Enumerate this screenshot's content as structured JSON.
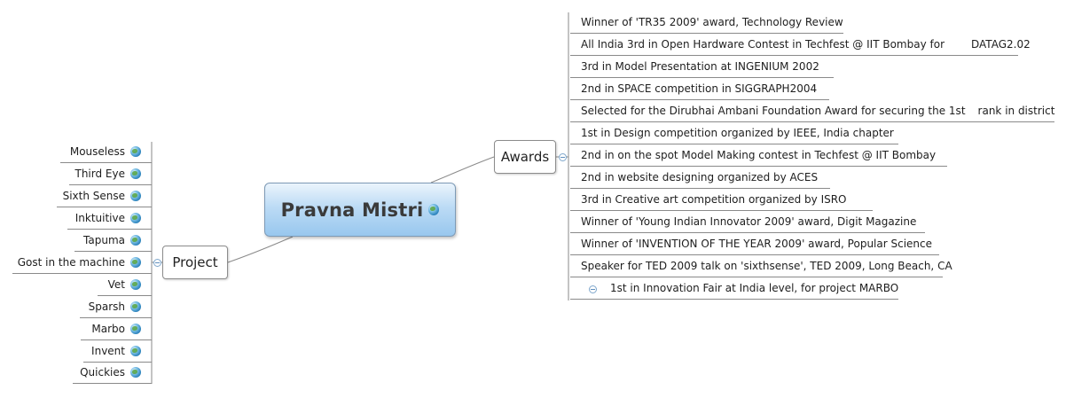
{
  "central": {
    "title": "Pravna Mistri",
    "icon": "globe-icon"
  },
  "awards": {
    "label": "Awards",
    "items": [
      "Winner of 'TR35 2009' award, Technology Review",
      "All India 3rd in Open Hardware Contest in Techfest @ IIT Bombay for",
      "3rd in Model Presentation at INGENIUM 2002",
      "2nd in SPACE competition in SIGGRAPH2004",
      "Selected for the Dirubhai Ambani Foundation Award for securing the 1st",
      "1st in Design competition organized by IEEE, India chapter",
      "2nd in on the spot Model Making contest in Techfest @ IIT Bombay",
      "2nd in website designing organized by ACES",
      "3rd in Creative art competition organized by ISRO",
      "Winner of 'Young Indian Innovator 2009' award, Digit Magazine",
      "Winner of 'INVENTION OF THE YEAR 2009' award, Popular Science",
      "Speaker for TED 2009 talk on 'sixthsense', TED 2009, Long Beach, CA",
      "1st in Innovation Fair at India level, for project MARBO"
    ],
    "item_suffixes": [
      "",
      "DATAG2.02",
      "",
      "",
      "rank in district",
      "",
      "",
      "",
      "",
      "",
      "",
      "",
      ""
    ]
  },
  "project": {
    "label": "Project",
    "items": [
      "Mouseless",
      "Third Eye",
      "Sixth Sense",
      "Inktuitive",
      "Tapuma",
      "Gost in the machine",
      "Vet",
      "Sparsh",
      "Marbo",
      "Invent",
      "Quickies"
    ]
  },
  "colors": {
    "central_fill": "#98c7ee",
    "central_border": "#7d9ab6",
    "connector": "#8a8a8a",
    "collapse": "#5f8fbe"
  }
}
